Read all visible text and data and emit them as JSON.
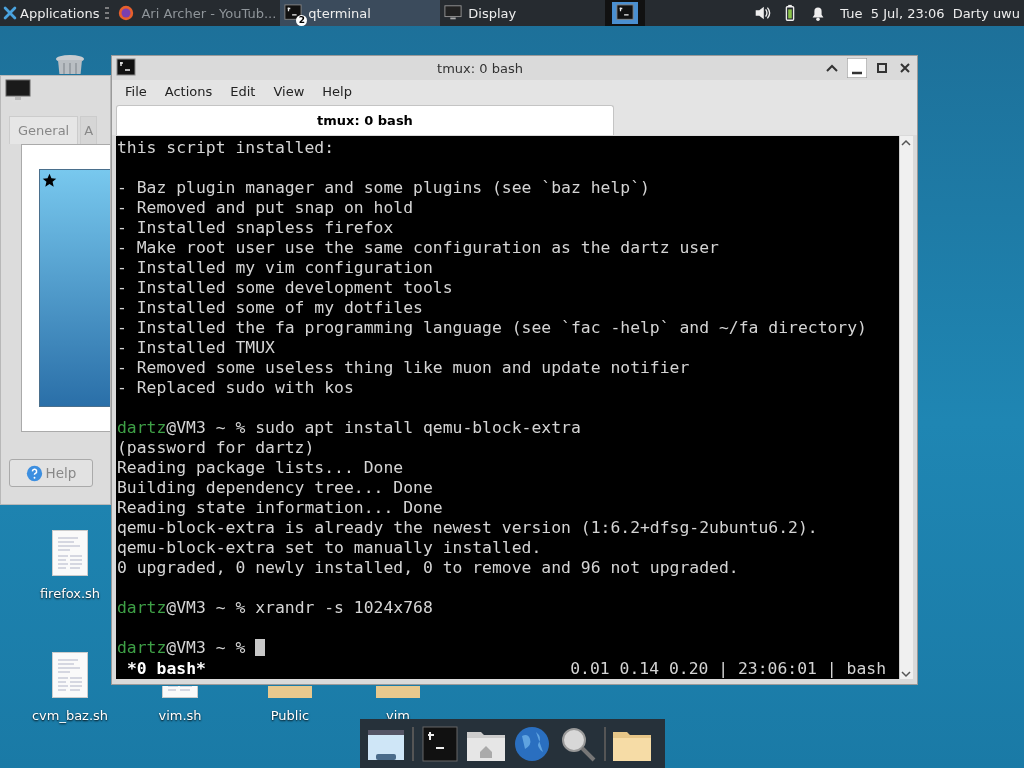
{
  "top_panel": {
    "applications_label": "Applications",
    "tasks": [
      {
        "title": "Ari Archer - YouTub...",
        "kind": "browser",
        "minimized": true,
        "selected": false
      },
      {
        "title": "qterminal",
        "kind": "terminal",
        "badge": "2",
        "minimized": false,
        "selected": true
      },
      {
        "title": "Display",
        "kind": "display",
        "minimized": false,
        "selected": false
      }
    ],
    "clock": "Tue  5 Jul, 23:06",
    "user": "Darty uwu"
  },
  "display_window": {
    "tabs": [
      {
        "label": "General",
        "selected": true
      },
      {
        "label": "A",
        "selected": false
      }
    ],
    "help_button": "Help"
  },
  "desktop_icons": [
    {
      "label": "firefox.sh",
      "kind": "file"
    },
    {
      "label": "cvm_baz.sh",
      "kind": "file"
    },
    {
      "label": "vim.sh",
      "kind": "file"
    },
    {
      "label": "Public",
      "kind": "folder"
    },
    {
      "label": "vim",
      "kind": "folder"
    }
  ],
  "terminal_window": {
    "title": "tmux: 0 bash",
    "menu": [
      "File",
      "Actions",
      "Edit",
      "View",
      "Help"
    ],
    "tabs": [
      {
        "label": "tmux: 0 bash",
        "selected": true
      }
    ],
    "lines": [
      {
        "kind": "output",
        "text": "this script installed:"
      },
      {
        "kind": "blank"
      },
      {
        "kind": "output",
        "text": "- Baz plugin manager and some plugins (see `baz help`)"
      },
      {
        "kind": "output",
        "text": "- Removed and put snap on hold"
      },
      {
        "kind": "output",
        "text": "- Installed snapless firefox"
      },
      {
        "kind": "output",
        "text": "- Make root user use the same configuration as the dartz user"
      },
      {
        "kind": "output",
        "text": "- Installed my vim configuration"
      },
      {
        "kind": "output",
        "text": "- Installed some development tools"
      },
      {
        "kind": "output",
        "text": "- Installed some of my dotfiles"
      },
      {
        "kind": "output",
        "text": "- Installed the fa programming language (see `fac -help` and ~/fa directory)"
      },
      {
        "kind": "output",
        "text": "- Installed TMUX"
      },
      {
        "kind": "output",
        "text": "- Removed some useless thing like muon and update notifier"
      },
      {
        "kind": "output",
        "text": "- Replaced sudo with kos"
      },
      {
        "kind": "blank"
      },
      {
        "kind": "prompt",
        "user": "dartz",
        "text": "@VM3 ~ % sudo apt install qemu-block-extra"
      },
      {
        "kind": "output",
        "text": "(password for dartz)"
      },
      {
        "kind": "output",
        "text": "Reading package lists... Done"
      },
      {
        "kind": "output",
        "text": "Building dependency tree... Done"
      },
      {
        "kind": "output",
        "text": "Reading state information... Done"
      },
      {
        "kind": "output",
        "text": "qemu-block-extra is already the newest version (1:6.2+dfsg-2ubuntu6.2)."
      },
      {
        "kind": "output",
        "text": "qemu-block-extra set to manually installed."
      },
      {
        "kind": "output",
        "text": "0 upgraded, 0 newly installed, 0 to remove and 96 not upgraded."
      },
      {
        "kind": "blank"
      },
      {
        "kind": "prompt",
        "user": "dartz",
        "text": "@VM3 ~ % xrandr -s 1024x768"
      },
      {
        "kind": "blank"
      },
      {
        "kind": "prompt",
        "user": "dartz",
        "text": "@VM3 ~ %",
        "cursor": true
      }
    ],
    "status_left": "*0 bash*",
    "status_right": "0.01 0.14 0.20 | 23:06:01 | bash"
  }
}
